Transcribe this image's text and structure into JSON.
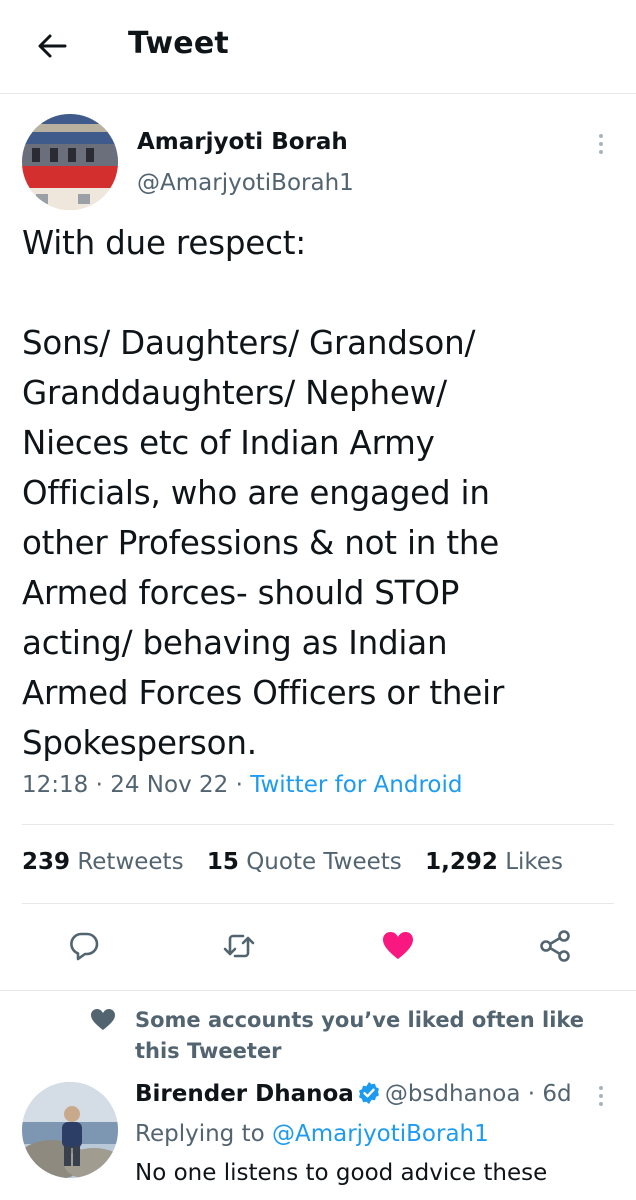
{
  "header": {
    "title": "Tweet",
    "back_icon": "arrow-left-icon"
  },
  "tweet": {
    "author_name": "Amarjyoti Borah",
    "author_handle": "@AmarjyotiBorah1",
    "text": "With due respect:\n\nSons/ Daughters/ Grandson/\nGranddaughters/ Nephew/\nNieces etc of Indian Army\nOfficials, who are engaged in\nother Professions & not in the\nArmed forces- should STOP\nacting/ behaving as Indian\nArmed Forces Officers or their\nSpokesperson.",
    "time": "12:18",
    "date": "24 Nov 22",
    "source": "Twitter for Android",
    "separator": " · "
  },
  "stats": {
    "retweets_count": "239",
    "retweets_label": "Retweets",
    "quotes_count": "15",
    "quotes_label": "Quote Tweets",
    "likes_count": "1,292",
    "likes_label": "Likes"
  },
  "actions": {
    "reply_icon": "reply-icon",
    "retweet_icon": "retweet-icon",
    "like_icon": "heart-icon",
    "share_icon": "share-icon",
    "liked": true
  },
  "social_context": {
    "icon": "heart-icon",
    "text": "Some accounts you’ve liked often like this Tweeter"
  },
  "reply": {
    "author_name": "Birender Dhanoa",
    "verified": true,
    "author_handle": "@bsdhanoa",
    "time": "6d",
    "dot": " · ",
    "replying_prefix": "Replying to",
    "replying_to": "@AmarjyotiBorah1",
    "text": "No one listens to good advice these"
  },
  "colors": {
    "accent": "#1d9bf0",
    "like": "#f91880",
    "secondary_text": "#536471",
    "divider": "#e6e9eb"
  }
}
